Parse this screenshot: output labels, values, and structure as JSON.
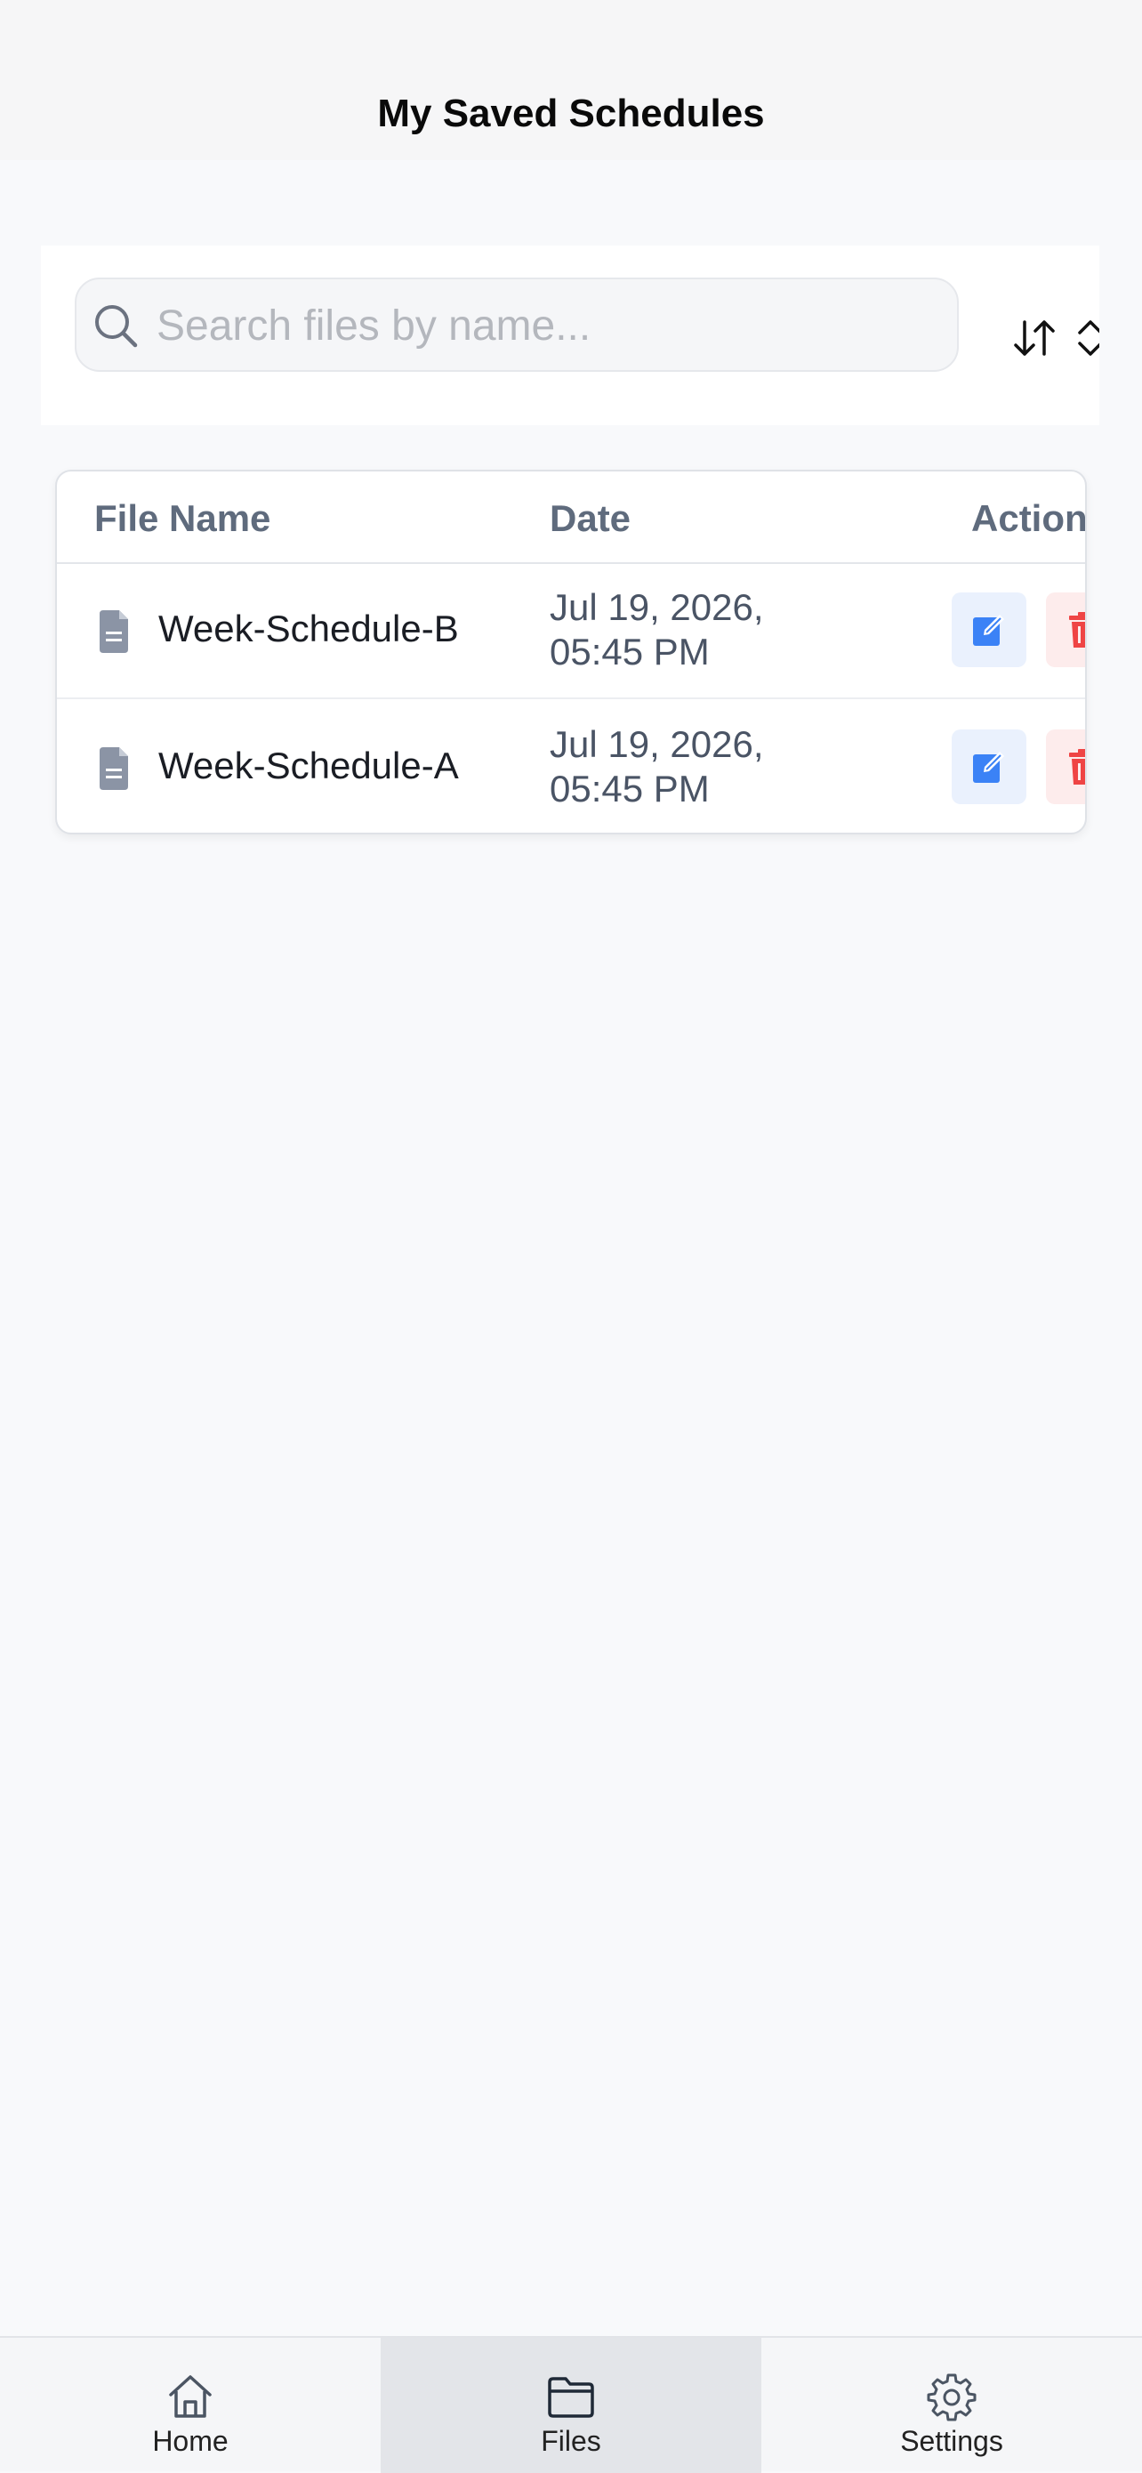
{
  "header": {
    "title": "My Saved Schedules"
  },
  "search": {
    "placeholder": "Search files by name...",
    "value": ""
  },
  "table": {
    "columns": [
      "File Name",
      "Date",
      "Actions"
    ],
    "rows": [
      {
        "name": "Week-Schedule-B",
        "date": "Jul 19, 2026, 05:45 PM"
      },
      {
        "name": "Week-Schedule-A",
        "date": "Jul 19, 2026, 05:45 PM"
      }
    ]
  },
  "nav": {
    "items": [
      {
        "label": "Home",
        "icon": "home-icon"
      },
      {
        "label": "Files",
        "icon": "folder-icon",
        "active": true
      },
      {
        "label": "Settings",
        "icon": "gear-icon"
      }
    ]
  },
  "colors": {
    "edit": "#3b82f6",
    "delete": "#ef4444",
    "header_text": "#5f6b7d",
    "active_nav": "#e3e5e9"
  }
}
